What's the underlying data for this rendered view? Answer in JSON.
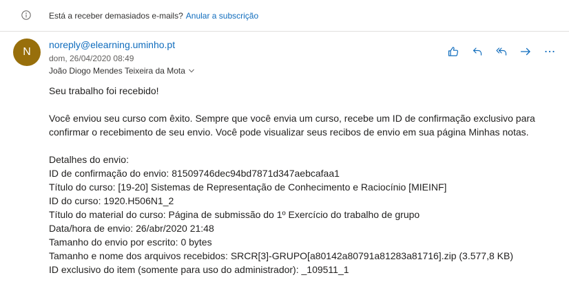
{
  "info_bar": {
    "icon": "info-icon",
    "text": "Está a receber demasiados e-mails?",
    "link": "Anular a subscrição"
  },
  "message": {
    "avatar_initial": "N",
    "avatar_color": "#986f0b",
    "sender": "noreply@elearning.uminho.pt",
    "date": "dom, 26/04/2020 08:49",
    "recipient": "João Diogo Mendes Teixeira da Mota"
  },
  "actions": [
    "like-icon",
    "reply-icon",
    "reply-all-icon",
    "forward-icon",
    "more-icon"
  ],
  "body": {
    "greeting": "Seu trabalho foi recebido!",
    "paragraph": "Você enviou seu curso com êxito. Sempre que você envia um curso, recebe um ID de confirmação exclusivo para confirmar o recebimento de seu envio. Você pode visualizar seus recibos de envio em sua página Minhas notas.",
    "details_title": "Detalhes do envio:",
    "details": [
      "ID de confirmação do envio: 81509746dec94bd7871d347aebcafaa1",
      "Título do curso: [19-20] Sistemas de Representação de Conhecimento e Raciocínio [MIEINF]",
      "ID do curso: 1920.H506N1_2",
      "Título do material do curso: Página de submissão do 1º Exercício do trabalho de grupo",
      "Data/hora de envio: 26/abr/2020 21:48",
      "Tamanho do envio por escrito: 0 bytes",
      "Tamanho e nome dos arquivos recebidos: SRCR[3]-GRUPO[a80142a80791a81283a81716].zip (3.577,8 KB)",
      "ID exclusivo do item (somente para uso do administrador): _109511_1"
    ]
  }
}
